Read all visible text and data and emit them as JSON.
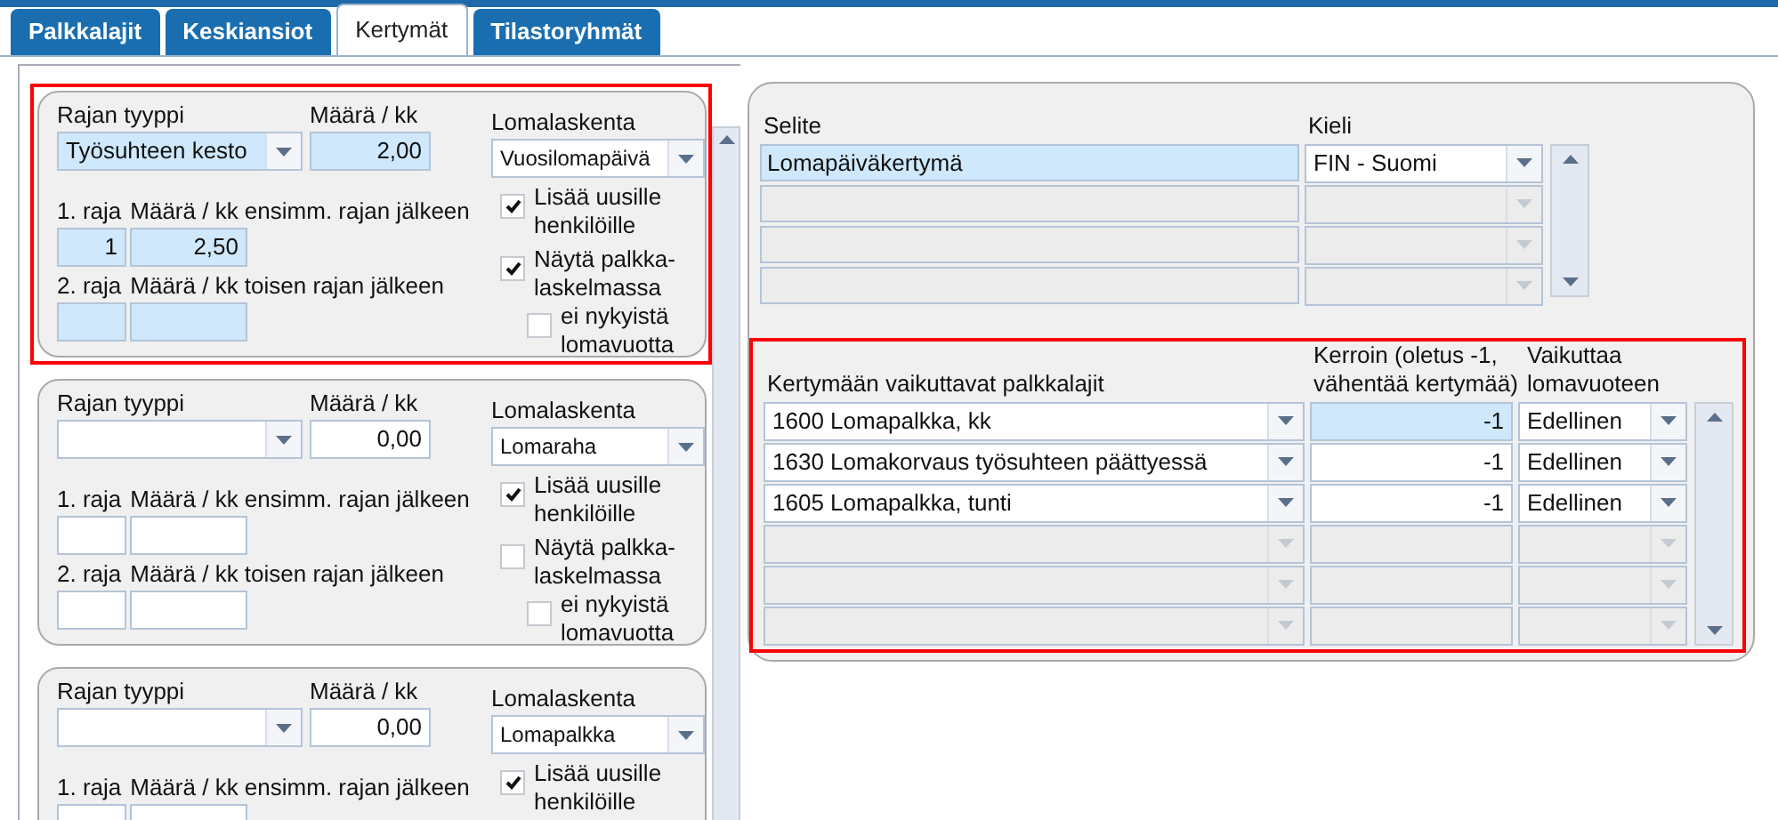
{
  "tabs": [
    {
      "label": "Palkkalajit",
      "selected": false
    },
    {
      "label": "Keskiansiot",
      "selected": false
    },
    {
      "label": "Kertymät",
      "selected": true
    },
    {
      "label": "Tilastoryhmät",
      "selected": false
    }
  ],
  "cards": [
    {
      "highlighted": true,
      "active": true,
      "type_label": "Rajan tyyppi",
      "type_value": "Työsuhteen kesto",
      "amount_label": "Määrä / kk",
      "amount_value": "2,00",
      "calc_label": "Lomalaskenta",
      "calc_value": "Vuosilomapäivä",
      "limit1_label": "1. raja",
      "limit1_value": "1",
      "amount1_label": "Määrä / kk ensimm. rajan jälkeen",
      "amount1_value": "2,50",
      "limit2_label": "2. raja",
      "amount2_label": "Määrä / kk toisen rajan jälkeen",
      "checkboxes": [
        {
          "label": "Lisää uusille henkilöille",
          "checked": true,
          "kind": "main"
        },
        {
          "label": "Näytä palkka-laskelmassa",
          "checked": true,
          "kind": "main"
        },
        {
          "label": "ei nykyistä lomavuotta",
          "checked": false,
          "kind": "sub"
        }
      ]
    },
    {
      "highlighted": false,
      "active": false,
      "type_label": "Rajan tyyppi",
      "amount_label": "Määrä / kk",
      "amount_value": "0,00",
      "calc_label": "Lomalaskenta",
      "calc_value": "Lomaraha",
      "limit1_label": "1. raja",
      "amount1_label": "Määrä / kk ensimm. rajan jälkeen",
      "limit2_label": "2. raja",
      "amount2_label": "Määrä / kk toisen rajan jälkeen",
      "checkboxes": [
        {
          "label": "Lisää uusille henkilöille",
          "checked": true,
          "kind": "main"
        },
        {
          "label": "Näytä palkka-laskelmassa",
          "checked": false,
          "kind": "main"
        },
        {
          "label": "ei nykyistä lomavuotta",
          "checked": false,
          "kind": "sub"
        }
      ]
    },
    {
      "highlighted": false,
      "active": false,
      "type_label": "Rajan tyyppi",
      "amount_label": "Määrä / kk",
      "amount_value": "0,00",
      "calc_label": "Lomalaskenta",
      "calc_value": "Lomapalkka",
      "limit1_label": "1. raja",
      "amount1_label": "Määrä / kk ensimm. rajan jälkeen",
      "checkboxes": [
        {
          "label": "Lisää uusille henkilöille",
          "checked": true,
          "kind": "main"
        }
      ]
    }
  ],
  "descriptions": {
    "columns": [
      "Selite",
      "Kieli"
    ],
    "rows": [
      {
        "text": "Lomapäiväkertymä",
        "language": "FIN - Suomi",
        "active": true,
        "disabled": false
      },
      {
        "disabled": true
      },
      {
        "disabled": true
      },
      {
        "disabled": true
      }
    ]
  },
  "wage_types": {
    "highlighted": true,
    "columns": [
      "Kertymään vaikuttavat palkkalajit",
      "Kerroin (oletus -1, vähentää kertymää)",
      "Vaikuttaa lomavuoteen"
    ],
    "rows": [
      {
        "wage_type": "1600 Lomapalkka, kk",
        "factor": "-1",
        "year": "Edellinen",
        "active": true,
        "disabled": false
      },
      {
        "wage_type": "1630 Lomakorvaus työsuhteen päättyessä",
        "factor": "-1",
        "year": "Edellinen",
        "active": false,
        "disabled": false
      },
      {
        "wage_type": "1605 Lomapalkka, tunti",
        "factor": "-1",
        "year": "Edellinen",
        "active": false,
        "disabled": false
      },
      {
        "disabled": true
      },
      {
        "disabled": true
      },
      {
        "disabled": true
      }
    ]
  }
}
